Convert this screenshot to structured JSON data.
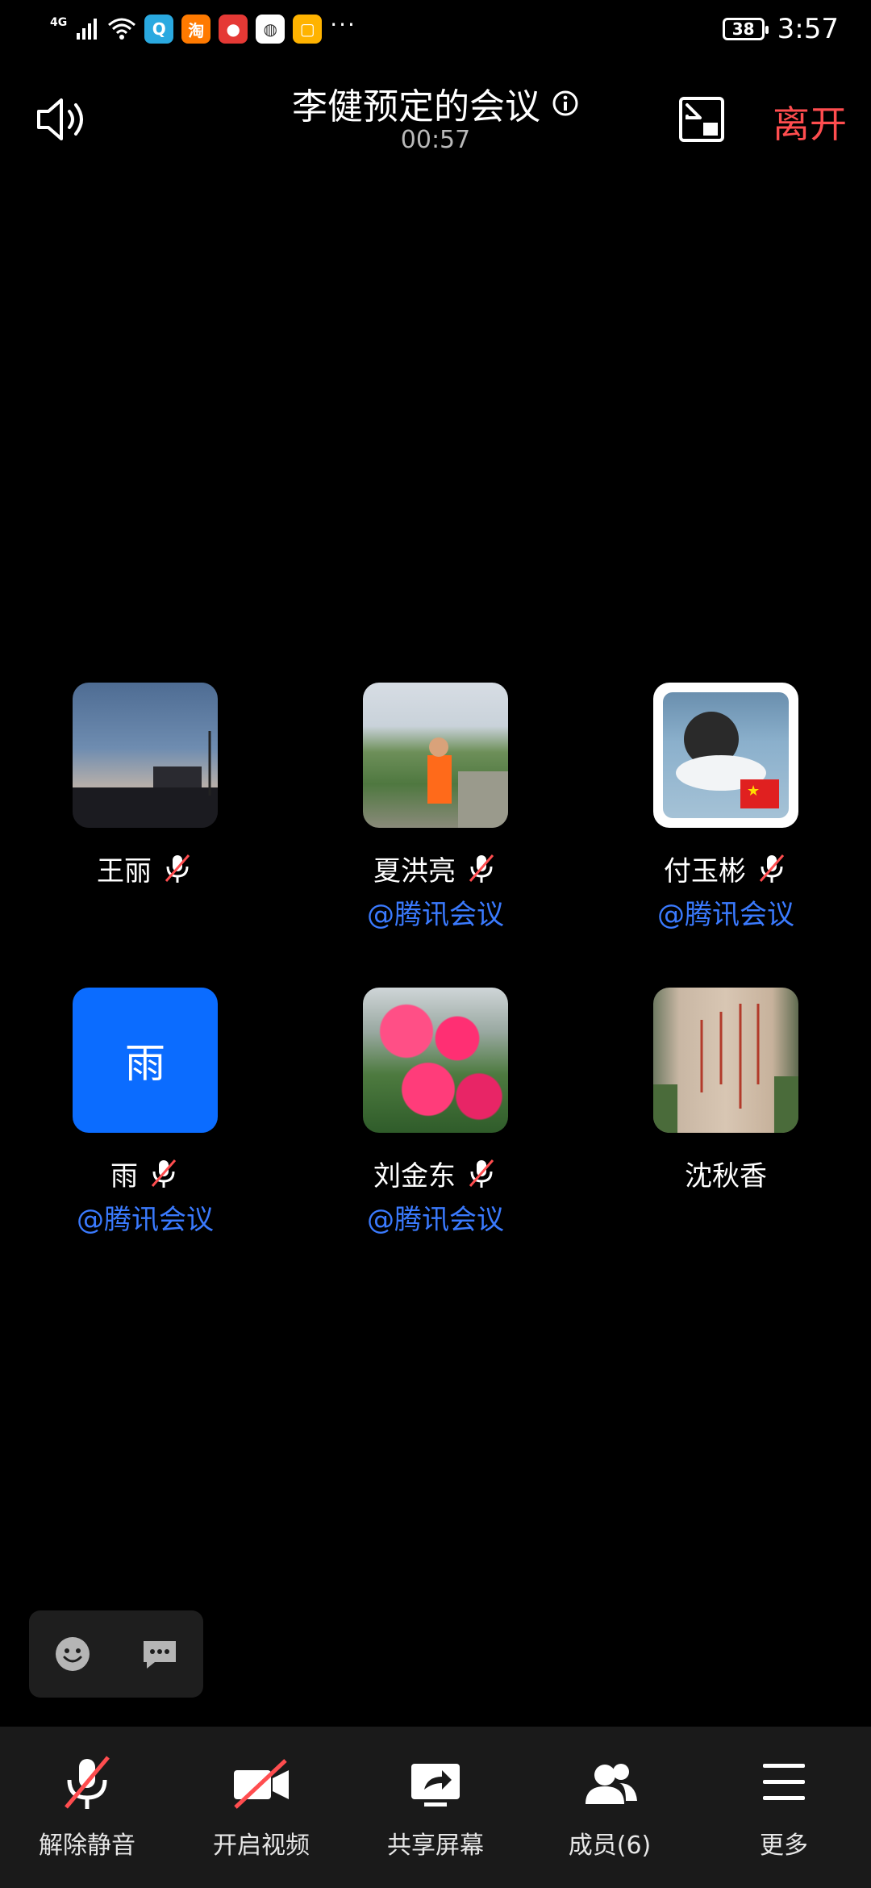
{
  "status_bar": {
    "network": "4G",
    "battery": "38",
    "time": "3:57",
    "more": "···",
    "app_icons": [
      {
        "name": "qq-icon",
        "color": "#2aa9e0",
        "glyph": "Q"
      },
      {
        "name": "taobao-icon",
        "color": "#ff7a00",
        "glyph": "淘"
      },
      {
        "name": "recorder-icon",
        "color": "#e53935",
        "glyph": "●"
      },
      {
        "name": "browser-icon",
        "color": "#ffffff",
        "glyph": "◍"
      },
      {
        "name": "notes-icon",
        "color": "#ffb300",
        "glyph": "▢"
      }
    ]
  },
  "header": {
    "title": "李健预定的会议",
    "timer": "00:57",
    "leave_label": "离开"
  },
  "participants": [
    {
      "name": "王丽",
      "source": "",
      "muted": true,
      "avatar": "sky"
    },
    {
      "name": "夏洪亮",
      "source": "@腾讯会议",
      "muted": true,
      "avatar": "mountain"
    },
    {
      "name": "付玉彬",
      "source": "@腾讯会议",
      "muted": true,
      "avatar": "person"
    },
    {
      "name": "雨",
      "source": "@腾讯会议",
      "muted": true,
      "avatar": "text",
      "avatar_text": "雨"
    },
    {
      "name": "刘金东",
      "source": "@腾讯会议",
      "muted": true,
      "avatar": "flower"
    },
    {
      "name": "沈秋香",
      "source": "",
      "muted": false,
      "avatar": "stone"
    }
  ],
  "toolbar": {
    "unmute_label": "解除静音",
    "video_label": "开启视频",
    "share_label": "共享屏幕",
    "members_label": "成员(6)",
    "more_label": "更多"
  },
  "colors": {
    "accent_blue": "#3a7afe",
    "leave_red": "#ff4d4f",
    "toolbar_bg": "#1a1a1a"
  }
}
